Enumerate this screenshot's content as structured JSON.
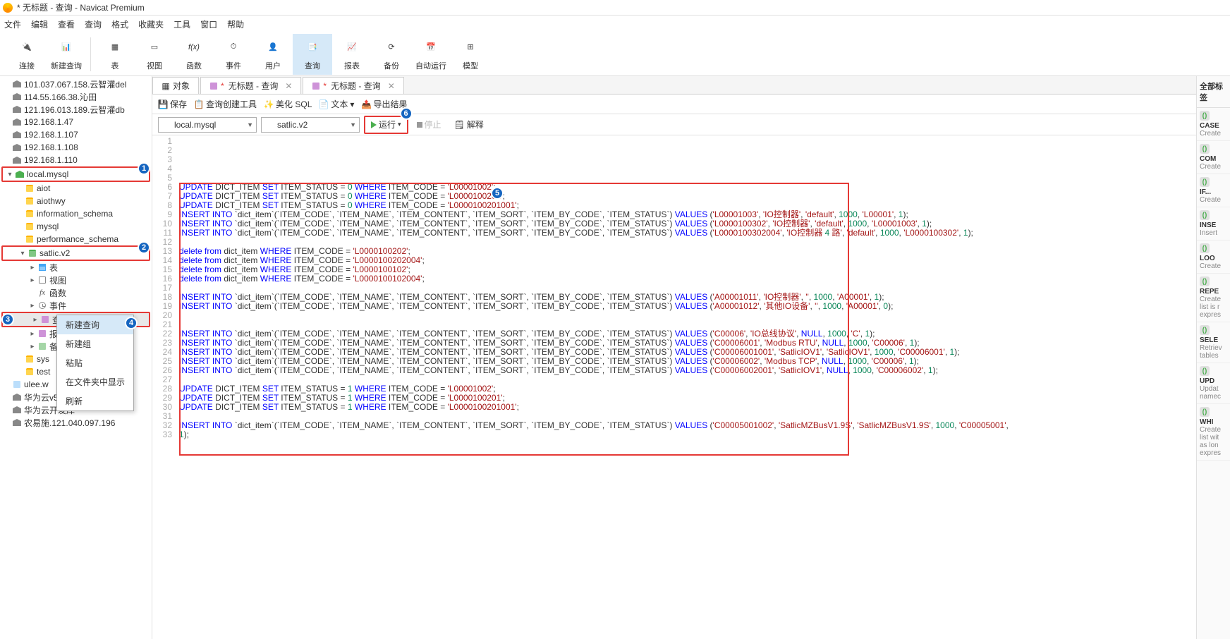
{
  "title": "* 无标题 - 查询 - Navicat Premium",
  "menus": [
    "文件",
    "编辑",
    "查看",
    "查询",
    "格式",
    "收藏夹",
    "工具",
    "窗口",
    "帮助"
  ],
  "toolbar": [
    {
      "label": "连接",
      "icon": "plug"
    },
    {
      "label": "新建查询",
      "icon": "newq"
    },
    {
      "label": "表",
      "icon": "table",
      "sep_before": true
    },
    {
      "label": "视图",
      "icon": "view"
    },
    {
      "label": "函数",
      "icon": "fx"
    },
    {
      "label": "事件",
      "icon": "event"
    },
    {
      "label": "用户",
      "icon": "user"
    },
    {
      "label": "查询",
      "icon": "query",
      "active": true
    },
    {
      "label": "报表",
      "icon": "report"
    },
    {
      "label": "备份",
      "icon": "backup"
    },
    {
      "label": "自动运行",
      "icon": "auto"
    },
    {
      "label": "模型",
      "icon": "model"
    }
  ],
  "tree": [
    {
      "label": "101.037.067.158.云智灌del",
      "lvl": 0,
      "icon": "conn"
    },
    {
      "label": "114.55.166.38.沁田",
      "lvl": 0,
      "icon": "conn"
    },
    {
      "label": "121.196.013.189.云智灌db",
      "lvl": 0,
      "icon": "conn"
    },
    {
      "label": "192.168.1.47",
      "lvl": 0,
      "icon": "conn"
    },
    {
      "label": "192.168.1.107",
      "lvl": 0,
      "icon": "conn"
    },
    {
      "label": "192.168.1.108",
      "lvl": 0,
      "icon": "conn"
    },
    {
      "label": "192.168.1.110",
      "lvl": 0,
      "icon": "conn"
    },
    {
      "label": "local.mysql",
      "lvl": 0,
      "icon": "conn-green",
      "arrow": "v",
      "hl": 1,
      "badge": 1
    },
    {
      "label": "aiot",
      "lvl": 1,
      "icon": "db"
    },
    {
      "label": "aiothwy",
      "lvl": 1,
      "icon": "db"
    },
    {
      "label": "information_schema",
      "lvl": 1,
      "icon": "db"
    },
    {
      "label": "mysql",
      "lvl": 1,
      "icon": "db"
    },
    {
      "label": "performance_schema",
      "lvl": 1,
      "icon": "db"
    },
    {
      "label": "satlic.v2",
      "lvl": 1,
      "icon": "db-green",
      "arrow": "v",
      "hl": 2,
      "badge": 2
    },
    {
      "label": "表",
      "lvl": 2,
      "icon": "tbl",
      "arrow": ">"
    },
    {
      "label": "视图",
      "lvl": 2,
      "icon": "view",
      "arrow": ">"
    },
    {
      "label": "函数",
      "lvl": 2,
      "icon": "fx"
    },
    {
      "label": "事件",
      "lvl": 2,
      "icon": "evt",
      "arrow": ">"
    },
    {
      "label": "查",
      "lvl": 2,
      "icon": "qry",
      "arrow": ">",
      "selected": true,
      "hl": 3,
      "badge": 3
    },
    {
      "label": "报",
      "lvl": 2,
      "icon": "qry",
      "arrow": ">"
    },
    {
      "label": "备",
      "lvl": 2,
      "icon": "bk",
      "arrow": ">"
    },
    {
      "label": "sys",
      "lvl": 1,
      "icon": "db"
    },
    {
      "label": "test",
      "lvl": 1,
      "icon": "db"
    },
    {
      "label": "ulee.w",
      "lvl": 0,
      "icon": "link"
    },
    {
      "label": "华为云v5.124.70.11.149",
      "lvl": 0,
      "icon": "conn"
    },
    {
      "label": "华为云开发库",
      "lvl": 0,
      "icon": "conn"
    },
    {
      "label": "农易施.121.040.097.196",
      "lvl": 0,
      "icon": "conn"
    }
  ],
  "context_menu": {
    "items": [
      "新建查询",
      "新建组",
      "粘贴",
      "在文件夹中显示",
      "刷新"
    ],
    "hover_index": 0,
    "badge": 4
  },
  "tabs": [
    {
      "label": "对象",
      "icon": "obj"
    },
    {
      "label": "无标题 - 查询",
      "icon": "qry",
      "dirty": true,
      "closable": true
    },
    {
      "label": "无标题 - 查询",
      "icon": "qry",
      "dirty": true,
      "closable": true
    }
  ],
  "sub_toolbar": {
    "save": "保存",
    "qbuilder": "查询创建工具",
    "beautify": "美化 SQL",
    "text": "文本",
    "export": "导出结果"
  },
  "query_bar": {
    "conn": "local.mysql",
    "db": "satlic.v2",
    "run": "运行",
    "stop": "停止",
    "explain": "解释",
    "badge": 6
  },
  "code_lines": [
    "",
    "",
    "",
    "",
    "",
    "UPDATE DICT_ITEM SET ITEM_STATUS = 0 WHERE ITEM_CODE = 'L00001002';",
    "UPDATE DICT_ITEM SET ITEM_STATUS = 0 WHERE ITEM_CODE = 'L0000100201';",
    "UPDATE DICT_ITEM SET ITEM_STATUS = 0 WHERE ITEM_CODE = 'L0000100201001';",
    "INSERT INTO `dict_item`(`ITEM_CODE`, `ITEM_NAME`, `ITEM_CONTENT`, `ITEM_SORT`, `ITEM_BY_CODE`, `ITEM_STATUS`) VALUES ('L00001003', 'IO控制器', 'default', 1000, 'L00001', 1);",
    "INSERT INTO `dict_item`(`ITEM_CODE`, `ITEM_NAME`, `ITEM_CONTENT`, `ITEM_SORT`, `ITEM_BY_CODE`, `ITEM_STATUS`) VALUES ('L0000100302', 'IO控制器', 'default', 1000, 'L00001003', 1);",
    "INSERT INTO `dict_item`(`ITEM_CODE`, `ITEM_NAME`, `ITEM_CONTENT`, `ITEM_SORT`, `ITEM_BY_CODE`, `ITEM_STATUS`) VALUES ('L0000100302004', 'IO控制器 4 路', 'default', 1000, 'L0000100302', 1);",
    "",
    "delete from dict_item WHERE ITEM_CODE = 'L0000100202';",
    "delete from dict_item WHERE ITEM_CODE = 'L0000100202004';",
    "delete from dict_item WHERE ITEM_CODE = 'L0000100102';",
    "delete from dict_item WHERE ITEM_CODE = 'L0000100102004';",
    "",
    "INSERT INTO `dict_item`(`ITEM_CODE`, `ITEM_NAME`, `ITEM_CONTENT`, `ITEM_SORT`, `ITEM_BY_CODE`, `ITEM_STATUS`) VALUES ('A00001011', 'IO控制器', '', 1000, 'A00001', 1);",
    "INSERT INTO `dict_item`(`ITEM_CODE`, `ITEM_NAME`, `ITEM_CONTENT`, `ITEM_SORT`, `ITEM_BY_CODE`, `ITEM_STATUS`) VALUES ('A00001012', '其他IO设备', '', 1000, 'A00001', 0);",
    "",
    "",
    "INSERT INTO `dict_item`(`ITEM_CODE`, `ITEM_NAME`, `ITEM_CONTENT`, `ITEM_SORT`, `ITEM_BY_CODE`, `ITEM_STATUS`) VALUES ('C00006', 'IO总线协议', NULL, 1000, 'C', 1);",
    "INSERT INTO `dict_item`(`ITEM_CODE`, `ITEM_NAME`, `ITEM_CONTENT`, `ITEM_SORT`, `ITEM_BY_CODE`, `ITEM_STATUS`) VALUES ('C00006001', 'Modbus RTU', NULL, 1000, 'C00006', 1);",
    "INSERT INTO `dict_item`(`ITEM_CODE`, `ITEM_NAME`, `ITEM_CONTENT`, `ITEM_SORT`, `ITEM_BY_CODE`, `ITEM_STATUS`) VALUES ('C00006001001', 'SatlicIOV1', 'SatlicIOV1', 1000, 'C00006001', 1);",
    "INSERT INTO `dict_item`(`ITEM_CODE`, `ITEM_NAME`, `ITEM_CONTENT`, `ITEM_SORT`, `ITEM_BY_CODE`, `ITEM_STATUS`) VALUES ('C00006002', 'Modbus TCP', NULL, 1000, 'C00006', 1);",
    "INSERT INTO `dict_item`(`ITEM_CODE`, `ITEM_NAME`, `ITEM_CONTENT`, `ITEM_SORT`, `ITEM_BY_CODE`, `ITEM_STATUS`) VALUES ('C00006002001', 'SatlicIOV1', NULL, 1000, 'C00006002', 1);",
    "",
    "UPDATE DICT_ITEM SET ITEM_STATUS = 1 WHERE ITEM_CODE = 'L00001002';",
    "UPDATE DICT_ITEM SET ITEM_STATUS = 1 WHERE ITEM_CODE = 'L0000100201';",
    "UPDATE DICT_ITEM SET ITEM_STATUS = 1 WHERE ITEM_CODE = 'L0000100201001';",
    "",
    "INSERT INTO `dict_item`(`ITEM_CODE`, `ITEM_NAME`, `ITEM_CONTENT`, `ITEM_SORT`, `ITEM_BY_CODE`, `ITEM_STATUS`) VALUES ('C00005001002', 'SatlicMZBusV1.9S', 'SatlicMZBusV1.9S', 1000, 'C00005001',",
    "1);"
  ],
  "editor_badge": 5,
  "right_panel": {
    "title": "全部标签",
    "snippets": [
      {
        "t": "CASE",
        "d": "Create"
      },
      {
        "t": "COM",
        "d": "Create"
      },
      {
        "t": "IF...",
        "d": "Create"
      },
      {
        "t": "INSE",
        "d": "Insert"
      },
      {
        "t": "LOO",
        "d": "Create"
      },
      {
        "t": "REPE",
        "d": "Create list is r expres"
      },
      {
        "t": "SELE",
        "d": "Retriev tables"
      },
      {
        "t": "UPD",
        "d": "Updat namec"
      },
      {
        "t": "WHI",
        "d": "Create list wit as lon expres"
      }
    ]
  }
}
